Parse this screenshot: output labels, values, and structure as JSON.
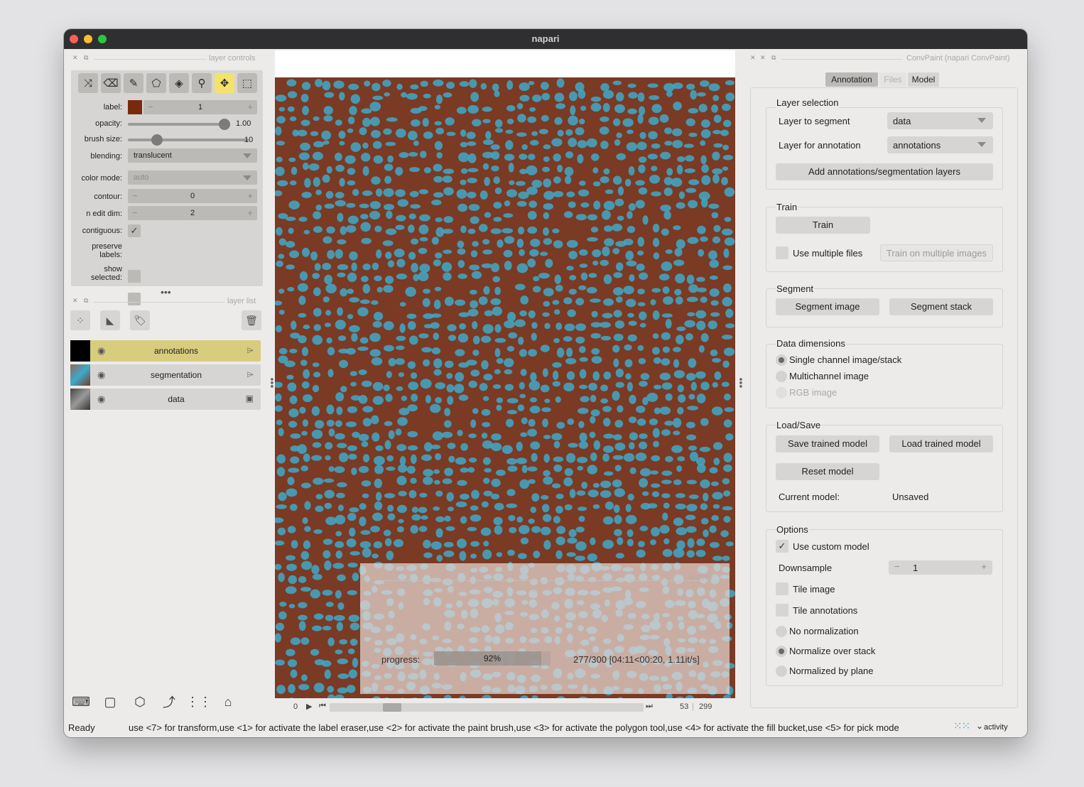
{
  "window": {
    "title": "napari"
  },
  "layer_controls": {
    "header": "layer controls",
    "label_label": "label:",
    "label_value": "1",
    "label_color": "#7a2a0c",
    "opacity_label": "opacity:",
    "opacity_value": "1.00",
    "opacity_fraction": 1.0,
    "brush_size_label": "brush size:",
    "brush_size_value": "10",
    "brush_size_fraction": 0.3,
    "blending_label": "blending:",
    "blending_value": "translucent",
    "color_mode_label": "color mode:",
    "color_mode_value": "auto",
    "contour_label": "contour:",
    "contour_value": "0",
    "n_edit_dim_label": "n edit dim:",
    "n_edit_dim_value": "2",
    "contiguous_label": "contiguous:",
    "contiguous_checked": true,
    "preserve_labels_label": "preserve labels:",
    "preserve_labels_checked": false,
    "show_selected_label": "show selected:",
    "show_selected_checked": false,
    "tools": [
      "shuffle-icon",
      "eraser-icon",
      "paint-brush-icon",
      "polygon-icon",
      "fill-bucket-icon",
      "color-picker-icon",
      "pan-zoom-icon",
      "transform-icon"
    ],
    "active_tool": "pan-zoom-icon"
  },
  "layer_list": {
    "header": "layer list",
    "layers": [
      {
        "name": "annotations",
        "type_icon": "labels-icon",
        "selected": true
      },
      {
        "name": "segmentation",
        "type_icon": "labels-icon",
        "selected": false
      },
      {
        "name": "data",
        "type_icon": "image-icon",
        "selected": false
      }
    ]
  },
  "activity_panel": {
    "title": "activity",
    "progress_label": "progress:",
    "progress_percent": "92%",
    "progress_fraction": 0.92,
    "status": "277/300 [04:11<00:20, 1.11it/s]"
  },
  "dims_slider": {
    "min": "0",
    "current": "53",
    "max": "299"
  },
  "status_bar": {
    "status": "Ready",
    "hint": "use <7> for transform,use <1> for activate the label eraser,use <2> for activate the paint brush,use <3> for activate the polygon tool,use <4> for activate the fill bucket,use <5> for pick mode",
    "activity_label": "activity"
  },
  "convpaint": {
    "header": "ConvPaint (napari ConvPaint)",
    "tabs": [
      "Annotation",
      "Files",
      "Model"
    ],
    "layer_selection": {
      "title": "Layer selection",
      "layer_to_segment_label": "Layer to segment",
      "layer_to_segment_value": "data",
      "layer_for_annotation_label": "Layer for annotation",
      "layer_for_annotation_value": "annotations",
      "add_layers_button": "Add annotations/segmentation layers"
    },
    "train": {
      "title": "Train",
      "train_button": "Train",
      "use_multiple_files_label": "Use multiple files",
      "train_multiple_button": "Train on multiple images"
    },
    "segment": {
      "title": "Segment",
      "segment_image_button": "Segment image",
      "segment_stack_button": "Segment stack"
    },
    "data_dimensions": {
      "title": "Data dimensions",
      "options": [
        "Single channel image/stack",
        "Multichannel image",
        "RGB image"
      ],
      "selected": 0
    },
    "load_save": {
      "title": "Load/Save",
      "save_button": "Save trained model",
      "load_button": "Load trained model",
      "reset_button": "Reset model",
      "current_model_label": "Current model:",
      "current_model_value": "Unsaved"
    },
    "options": {
      "title": "Options",
      "use_custom_model_label": "Use custom model",
      "use_custom_model_checked": true,
      "downsample_label": "Downsample",
      "downsample_value": "1",
      "tile_image_label": "Tile image",
      "tile_annotations_label": "Tile annotations",
      "normalization": [
        "No normalization",
        "Normalize over stack",
        "Normalized by plane"
      ],
      "normalization_selected": 1
    }
  },
  "colors": {
    "accent_yellow": "#f4e26b",
    "selected_layer": "#d8cc7e",
    "image_background": "#7a3a24",
    "cell_color": "#3fa9c9"
  }
}
